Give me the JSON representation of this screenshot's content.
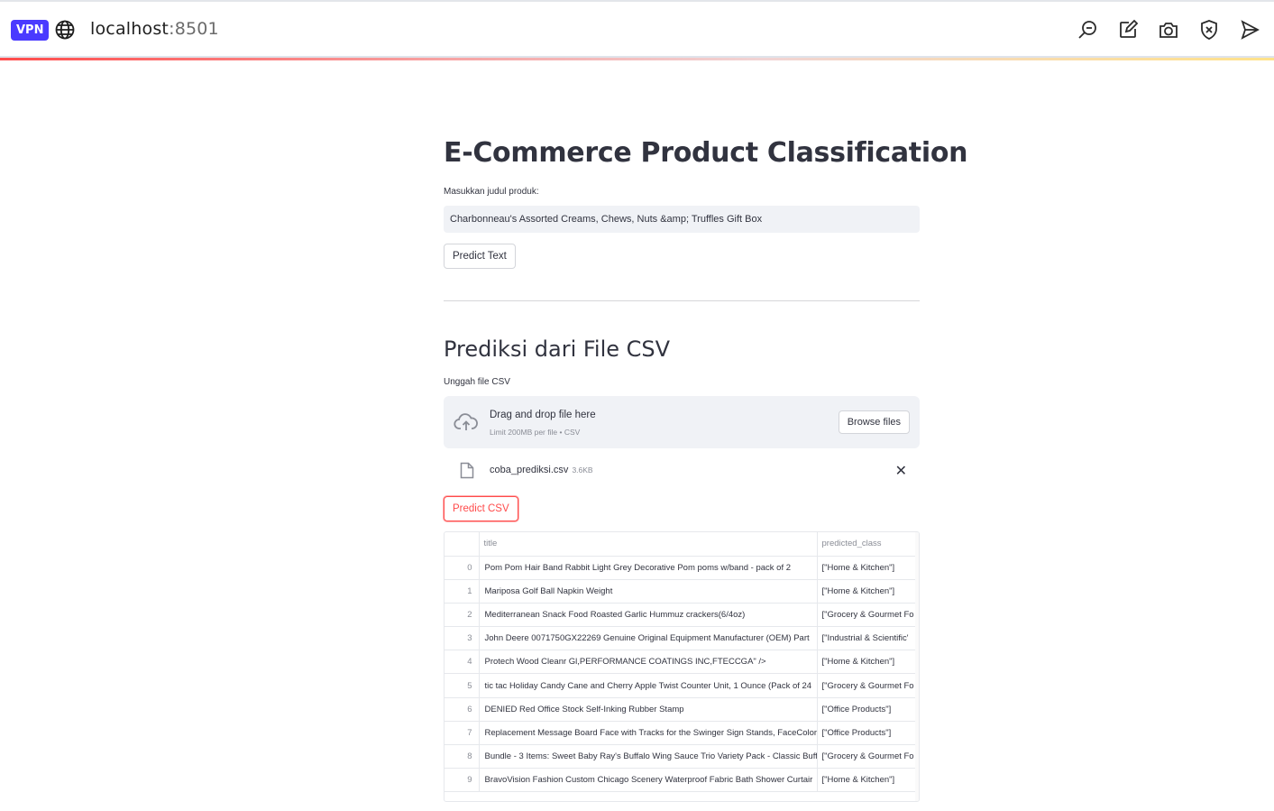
{
  "browser": {
    "vpn_label": "VPN",
    "url_host": "localhost",
    "url_port": ":8501",
    "toolbar_icons": [
      "zoom-search-icon",
      "edit-share-icon",
      "camera-icon",
      "shield-close-icon",
      "send-icon"
    ]
  },
  "colors": {
    "accent": "#ff4b4b",
    "vpn_badge": "#4a3aff",
    "input_bg": "#f0f2f6",
    "text": "#31333f"
  },
  "page": {
    "title": "E-Commerce Product Classification",
    "text_input_label": "Masukkan judul produk:",
    "text_input_value": "Charbonneau's Assorted Creams, Chews, Nuts &amp; Truffles Gift Box",
    "predict_text_button": "Predict Text",
    "csv_section_title": "Prediksi dari File CSV",
    "upload_label": "Unggah file CSV",
    "dropzone_main": "Drag and drop file here",
    "dropzone_sub": "Limit 200MB per file • CSV",
    "browse_button": "Browse files",
    "uploaded_file_name": "coba_prediksi.csv",
    "uploaded_file_size": "3.6KB",
    "remove_file_icon": "close-icon",
    "predict_csv_button": "Predict CSV"
  },
  "dataframe": {
    "columns": [
      "",
      "title",
      "predicted_class"
    ],
    "rows": [
      {
        "idx": "0",
        "title": "Pom Pom Hair Band Rabbit Light Grey Decorative Pom poms w/band - pack of 2",
        "predicted_class": "[\"Home & Kitchen\"]"
      },
      {
        "idx": "1",
        "title": "Mariposa Golf Ball Napkin Weight",
        "predicted_class": "[\"Home & Kitchen\"]"
      },
      {
        "idx": "2",
        "title": "Mediterranean Snack Food Roasted Garlic Hummuz crackers(6/4oz)",
        "predicted_class": "[\"Grocery & Gourmet Fo"
      },
      {
        "idx": "3",
        "title": "John Deere 0071750GX22269 Genuine Original Equipment Manufacturer (OEM) Part",
        "predicted_class": "[\"Industrial & Scientific'"
      },
      {
        "idx": "4",
        "title": "Protech Wood Cleanr Gl,PERFORMANCE COATINGS INC,FTECCGA\" />",
        "predicted_class": "[\"Home & Kitchen\"]"
      },
      {
        "idx": "5",
        "title": "tic tac Holiday Candy Cane and Cherry Apple Twist Counter Unit, 1 Ounce (Pack of 24",
        "predicted_class": "[\"Grocery & Gourmet Fo"
      },
      {
        "idx": "6",
        "title": "DENIED Red Office Stock Self-Inking Rubber Stamp",
        "predicted_class": "[\"Office Products\"]"
      },
      {
        "idx": "7",
        "title": "Replacement Message Board Face with Tracks for the Swinger Sign Stands, FaceColor",
        "predicted_class": "[\"Office Products\"]"
      },
      {
        "idx": "8",
        "title": "Bundle - 3 Items: Sweet Baby Ray's Buffalo Wing Sauce Trio Variety Pack - Classic Buff",
        "predicted_class": "[\"Grocery & Gourmet Fo"
      },
      {
        "idx": "9",
        "title": "BravoVision Fashion Custom Chicago Scenery Waterproof Fabric Bath Shower Curtair",
        "predicted_class": "[\"Home & Kitchen\"]"
      }
    ]
  }
}
